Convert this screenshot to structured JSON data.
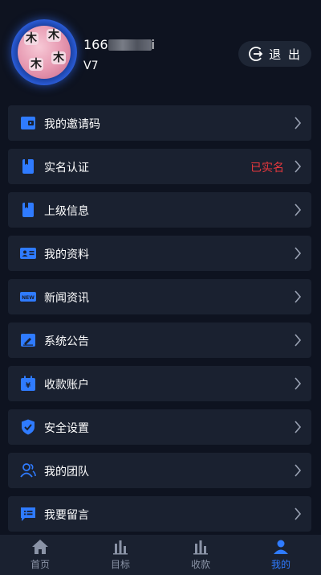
{
  "profile": {
    "phone_prefix": "166",
    "phone_suffix": "i",
    "level": "V7",
    "logout_label": "退 出"
  },
  "menu": [
    {
      "label": "我的邀请码",
      "icon": "wallet-icon",
      "status": ""
    },
    {
      "label": "实名认证",
      "icon": "bookmark-icon",
      "status": "已实名"
    },
    {
      "label": "上级信息",
      "icon": "bookmark-icon",
      "status": ""
    },
    {
      "label": "我的资料",
      "icon": "id-card-icon",
      "status": ""
    },
    {
      "label": "新闻资讯",
      "icon": "news-icon",
      "status": ""
    },
    {
      "label": "系统公告",
      "icon": "edit-board-icon",
      "status": ""
    },
    {
      "label": "收款账户",
      "icon": "yuan-calendar-icon",
      "status": ""
    },
    {
      "label": "安全设置",
      "icon": "shield-icon",
      "status": ""
    },
    {
      "label": "我的团队",
      "icon": "team-icon",
      "status": ""
    },
    {
      "label": "我要留言",
      "icon": "message-icon",
      "status": ""
    }
  ],
  "tabs": [
    {
      "label": "首页",
      "icon": "home-icon",
      "active": false
    },
    {
      "label": "目标",
      "icon": "bar-chart-icon",
      "active": false
    },
    {
      "label": "收款",
      "icon": "bar-chart-icon",
      "active": false
    },
    {
      "label": "我的",
      "icon": "user-icon",
      "active": true
    }
  ],
  "colors": {
    "background": "#0e1320",
    "card": "#1a2130",
    "accent": "#2f7bff",
    "status_red": "#e8383d"
  }
}
